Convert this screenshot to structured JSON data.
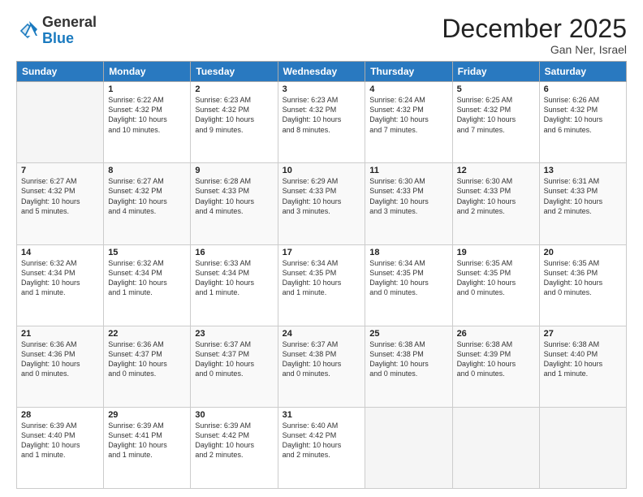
{
  "header": {
    "logo_general": "General",
    "logo_blue": "Blue",
    "month_year": "December 2025",
    "location": "Gan Ner, Israel"
  },
  "weekdays": [
    "Sunday",
    "Monday",
    "Tuesday",
    "Wednesday",
    "Thursday",
    "Friday",
    "Saturday"
  ],
  "weeks": [
    [
      {
        "day": "",
        "info": ""
      },
      {
        "day": "1",
        "info": "Sunrise: 6:22 AM\nSunset: 4:32 PM\nDaylight: 10 hours\nand 10 minutes."
      },
      {
        "day": "2",
        "info": "Sunrise: 6:23 AM\nSunset: 4:32 PM\nDaylight: 10 hours\nand 9 minutes."
      },
      {
        "day": "3",
        "info": "Sunrise: 6:23 AM\nSunset: 4:32 PM\nDaylight: 10 hours\nand 8 minutes."
      },
      {
        "day": "4",
        "info": "Sunrise: 6:24 AM\nSunset: 4:32 PM\nDaylight: 10 hours\nand 7 minutes."
      },
      {
        "day": "5",
        "info": "Sunrise: 6:25 AM\nSunset: 4:32 PM\nDaylight: 10 hours\nand 7 minutes."
      },
      {
        "day": "6",
        "info": "Sunrise: 6:26 AM\nSunset: 4:32 PM\nDaylight: 10 hours\nand 6 minutes."
      }
    ],
    [
      {
        "day": "7",
        "info": "Sunrise: 6:27 AM\nSunset: 4:32 PM\nDaylight: 10 hours\nand 5 minutes."
      },
      {
        "day": "8",
        "info": "Sunrise: 6:27 AM\nSunset: 4:32 PM\nDaylight: 10 hours\nand 4 minutes."
      },
      {
        "day": "9",
        "info": "Sunrise: 6:28 AM\nSunset: 4:33 PM\nDaylight: 10 hours\nand 4 minutes."
      },
      {
        "day": "10",
        "info": "Sunrise: 6:29 AM\nSunset: 4:33 PM\nDaylight: 10 hours\nand 3 minutes."
      },
      {
        "day": "11",
        "info": "Sunrise: 6:30 AM\nSunset: 4:33 PM\nDaylight: 10 hours\nand 3 minutes."
      },
      {
        "day": "12",
        "info": "Sunrise: 6:30 AM\nSunset: 4:33 PM\nDaylight: 10 hours\nand 2 minutes."
      },
      {
        "day": "13",
        "info": "Sunrise: 6:31 AM\nSunset: 4:33 PM\nDaylight: 10 hours\nand 2 minutes."
      }
    ],
    [
      {
        "day": "14",
        "info": "Sunrise: 6:32 AM\nSunset: 4:34 PM\nDaylight: 10 hours\nand 1 minute."
      },
      {
        "day": "15",
        "info": "Sunrise: 6:32 AM\nSunset: 4:34 PM\nDaylight: 10 hours\nand 1 minute."
      },
      {
        "day": "16",
        "info": "Sunrise: 6:33 AM\nSunset: 4:34 PM\nDaylight: 10 hours\nand 1 minute."
      },
      {
        "day": "17",
        "info": "Sunrise: 6:34 AM\nSunset: 4:35 PM\nDaylight: 10 hours\nand 1 minute."
      },
      {
        "day": "18",
        "info": "Sunrise: 6:34 AM\nSunset: 4:35 PM\nDaylight: 10 hours\nand 0 minutes."
      },
      {
        "day": "19",
        "info": "Sunrise: 6:35 AM\nSunset: 4:35 PM\nDaylight: 10 hours\nand 0 minutes."
      },
      {
        "day": "20",
        "info": "Sunrise: 6:35 AM\nSunset: 4:36 PM\nDaylight: 10 hours\nand 0 minutes."
      }
    ],
    [
      {
        "day": "21",
        "info": "Sunrise: 6:36 AM\nSunset: 4:36 PM\nDaylight: 10 hours\nand 0 minutes."
      },
      {
        "day": "22",
        "info": "Sunrise: 6:36 AM\nSunset: 4:37 PM\nDaylight: 10 hours\nand 0 minutes."
      },
      {
        "day": "23",
        "info": "Sunrise: 6:37 AM\nSunset: 4:37 PM\nDaylight: 10 hours\nand 0 minutes."
      },
      {
        "day": "24",
        "info": "Sunrise: 6:37 AM\nSunset: 4:38 PM\nDaylight: 10 hours\nand 0 minutes."
      },
      {
        "day": "25",
        "info": "Sunrise: 6:38 AM\nSunset: 4:38 PM\nDaylight: 10 hours\nand 0 minutes."
      },
      {
        "day": "26",
        "info": "Sunrise: 6:38 AM\nSunset: 4:39 PM\nDaylight: 10 hours\nand 0 minutes."
      },
      {
        "day": "27",
        "info": "Sunrise: 6:38 AM\nSunset: 4:40 PM\nDaylight: 10 hours\nand 1 minute."
      }
    ],
    [
      {
        "day": "28",
        "info": "Sunrise: 6:39 AM\nSunset: 4:40 PM\nDaylight: 10 hours\nand 1 minute."
      },
      {
        "day": "29",
        "info": "Sunrise: 6:39 AM\nSunset: 4:41 PM\nDaylight: 10 hours\nand 1 minute."
      },
      {
        "day": "30",
        "info": "Sunrise: 6:39 AM\nSunset: 4:42 PM\nDaylight: 10 hours\nand 2 minutes."
      },
      {
        "day": "31",
        "info": "Sunrise: 6:40 AM\nSunset: 4:42 PM\nDaylight: 10 hours\nand 2 minutes."
      },
      {
        "day": "",
        "info": ""
      },
      {
        "day": "",
        "info": ""
      },
      {
        "day": "",
        "info": ""
      }
    ]
  ]
}
